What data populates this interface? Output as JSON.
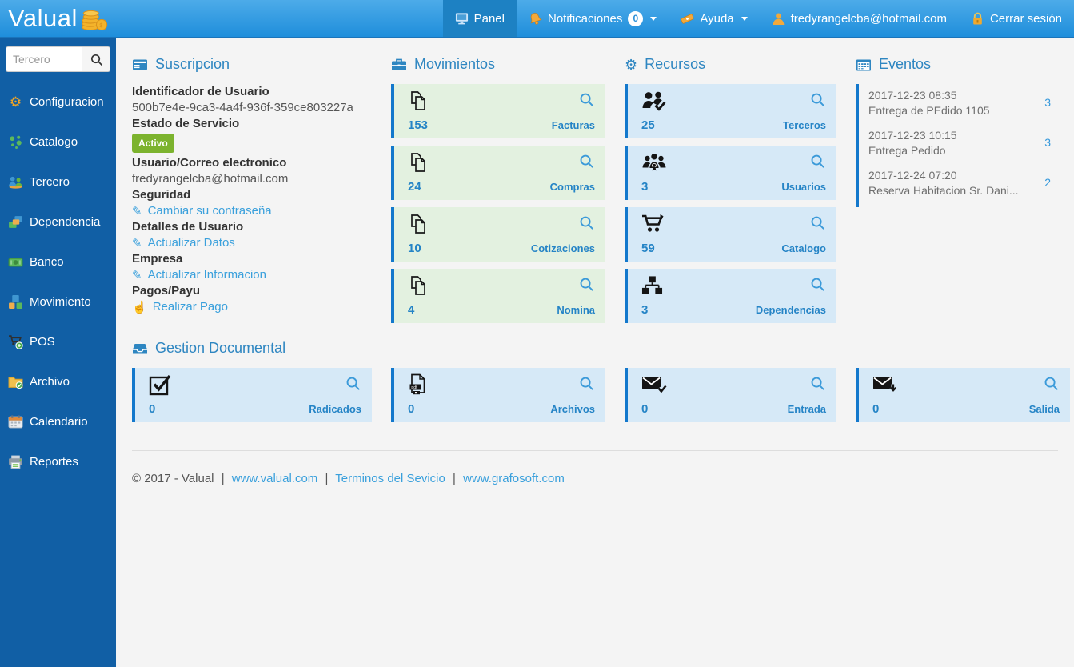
{
  "navbar": {
    "brand": "Valual",
    "panel": {
      "label": "Panel"
    },
    "notifications": {
      "label": "Notificaciones",
      "badge": "0"
    },
    "help": {
      "label": "Ayuda"
    },
    "user": {
      "label": "fredyrangelcba@hotmail.com"
    },
    "logout": {
      "label": "Cerrar sesión"
    }
  },
  "sidebar": {
    "search_placeholder": "Tercero",
    "items": [
      {
        "label": "Configuracion",
        "icon": "gear-icon"
      },
      {
        "label": "Catalogo",
        "icon": "catalog-dots-icon"
      },
      {
        "label": "Tercero",
        "icon": "people-icon"
      },
      {
        "label": "Dependencia",
        "icon": "layers-icon"
      },
      {
        "label": "Banco",
        "icon": "cash-icon"
      },
      {
        "label": "Movimiento",
        "icon": "blocks-icon"
      },
      {
        "label": "POS",
        "icon": "cart-plus-icon"
      },
      {
        "label": "Archivo",
        "icon": "folder-check-icon"
      },
      {
        "label": "Calendario",
        "icon": "calendar-icon"
      },
      {
        "label": "Reportes",
        "icon": "printer-icon"
      }
    ]
  },
  "suscripcion": {
    "title": "Suscripcion",
    "fields": [
      {
        "label": "Identificador de Usuario",
        "value": "500b7e4e-9ca3-4a4f-936f-359ce803227a"
      },
      {
        "label": "Estado de Servicio",
        "badge": "Activo"
      },
      {
        "label": "Usuario/Correo electronico",
        "value": "fredyrangelcba@hotmail.com"
      },
      {
        "label": "Seguridad",
        "link": "Cambiar su contraseña"
      },
      {
        "label": "Detalles de Usuario",
        "link": "Actualizar Datos"
      },
      {
        "label": "Empresa",
        "link": "Actualizar Informacion"
      },
      {
        "label": "Pagos/Payu",
        "link": "Realizar Pago"
      }
    ]
  },
  "movimientos": {
    "title": "Movimientos",
    "cards": [
      {
        "count": "153",
        "label": "Facturas",
        "icon": "documents-icon"
      },
      {
        "count": "24",
        "label": "Compras",
        "icon": "documents-icon"
      },
      {
        "count": "10",
        "label": "Cotizaciones",
        "icon": "documents-icon"
      },
      {
        "count": "4",
        "label": "Nomina",
        "icon": "documents-icon"
      }
    ]
  },
  "recursos": {
    "title": "Recursos",
    "cards": [
      {
        "count": "25",
        "label": "Terceros",
        "icon": "person-check-icon"
      },
      {
        "count": "3",
        "label": "Usuarios",
        "icon": "user-group-icon"
      },
      {
        "count": "59",
        "label": "Catalogo",
        "icon": "shopping-cart-icon"
      },
      {
        "count": "3",
        "label": "Dependencias",
        "icon": "sitemap-icon"
      }
    ]
  },
  "eventos": {
    "title": "Eventos",
    "items": [
      {
        "date": "2017-12-23 08:35",
        "title": "Entrega de PEdido 1105",
        "count": "3"
      },
      {
        "date": "2017-12-23 10:15",
        "title": "Entrega Pedido",
        "count": "3"
      },
      {
        "date": "2017-12-24 07:20",
        "title": "Reserva Habitacion Sr. Dani...",
        "count": "2"
      }
    ]
  },
  "gestion": {
    "title": "Gestion Documental",
    "cards": [
      {
        "count": "0",
        "label": "Radicados",
        "icon": "checkbox-icon"
      },
      {
        "count": "0",
        "label": "Archivos",
        "icon": "pdf-file-icon"
      },
      {
        "count": "0",
        "label": "Entrada",
        "icon": "mail-in-icon"
      },
      {
        "count": "0",
        "label": "Salida",
        "icon": "mail-out-icon"
      }
    ]
  },
  "footer": {
    "copyright": "© 2017 - Valual",
    "separator": "|",
    "links": [
      {
        "label": "www.valual.com"
      },
      {
        "label": "Terminos del Sevicio"
      },
      {
        "label": "www.grafosoft.com"
      }
    ]
  },
  "icons": {
    "pencil_glyph": "✎",
    "hand_glyph": "☝",
    "gear_glyph": "⚙"
  },
  "colors": {
    "accent": "#2e86c1",
    "card_green": "#e3f1e0",
    "card_blue": "#d6e9f7",
    "card_border": "#1378cc",
    "badge_green": "#7cb32e",
    "link": "#3aa0dc",
    "sidebar_bg": "#115fa5",
    "navbar_active": "#1d81c3"
  }
}
